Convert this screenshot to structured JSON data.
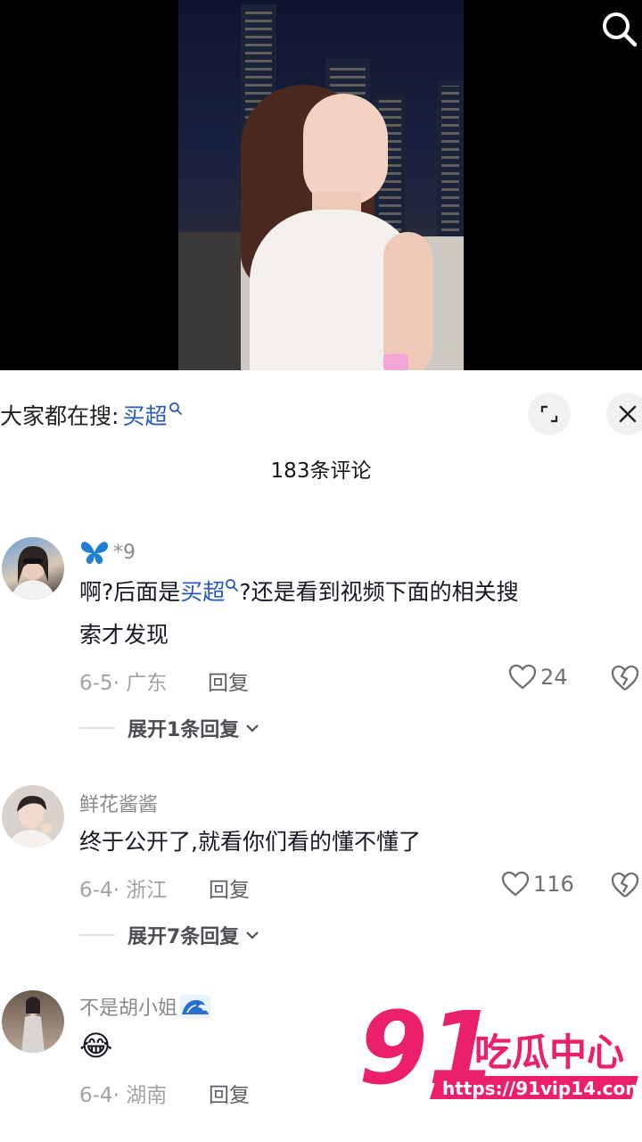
{
  "search_hint": {
    "label": "大家都在搜:",
    "keyword": "买超"
  },
  "comment_count": "183条评论",
  "comments": [
    {
      "name": "*9",
      "text_parts": [
        "啊?后面是",
        "买超",
        "?还是看到视频下面的相关搜",
        "索才发现"
      ],
      "date_loc": "6-5· 广东",
      "reply": "回复",
      "likes": "24",
      "expand": "展开1条回复"
    },
    {
      "name": "鲜花酱酱",
      "text": "终于公开了,就看你们看的懂不懂了",
      "date_loc": "6-4· 浙江",
      "reply": "回复",
      "likes": "116",
      "expand": "展开7条回复"
    },
    {
      "name": "不是胡小姐",
      "emoji": "😂",
      "date_loc": "6-4· 湖南",
      "reply": "回复"
    }
  ],
  "watermark": {
    "number": "91",
    "brand": "吃瓜中心",
    "url": "https://91vip14.com"
  },
  "colors": {
    "link": "#2a5bb7",
    "watermark": "#ec1f6b",
    "text": "#161823",
    "muted": "#a2a2a7"
  }
}
